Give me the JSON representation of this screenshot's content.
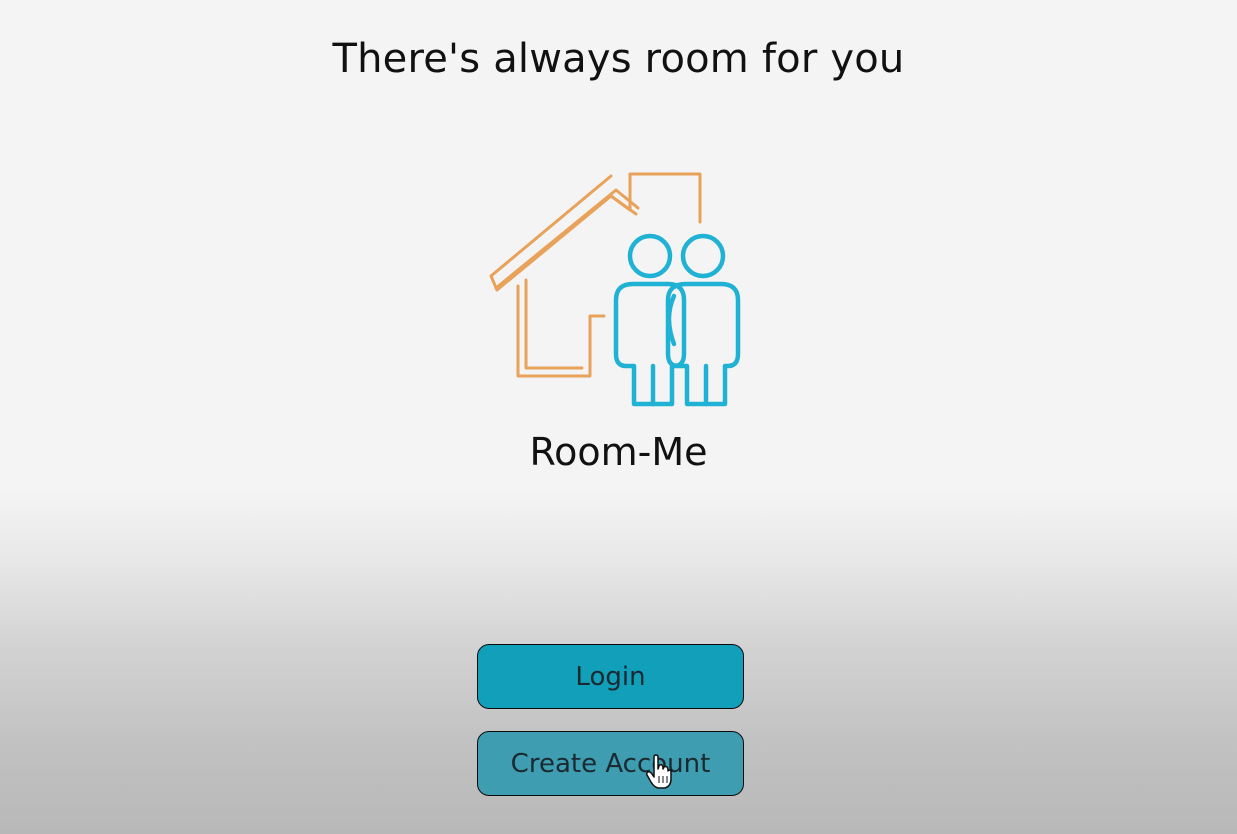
{
  "header": {
    "tagline": "There's always room for you"
  },
  "brand": {
    "name": "Room-Me",
    "logo_icon": "house-with-two-people-icon",
    "colors": {
      "house_outline": "#e8a25a",
      "people_outline": "#1fb2d4"
    }
  },
  "actions": {
    "login_label": "Login",
    "create_account_label": "Create Account"
  },
  "theme": {
    "login_button_color": "#119fba",
    "create_account_button_color": "#3e9db1",
    "background_top": "#f5f4f5",
    "background_bottom": "#b8b8b8"
  },
  "pointer": {
    "icon": "hand-pointer-cursor-icon"
  }
}
